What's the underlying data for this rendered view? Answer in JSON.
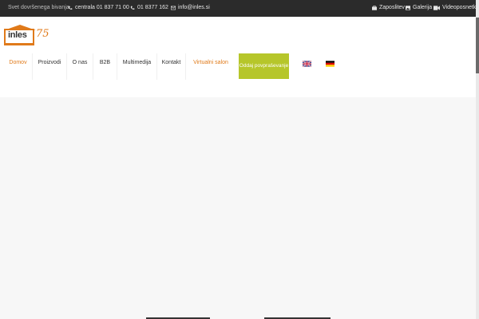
{
  "topbar": {
    "tagline": "Svet dovršenega bivanja",
    "phone_central": "centrala 01 837 71 00",
    "phone_secondary": "01 8377 162",
    "email": "info@inles.si",
    "links": [
      {
        "label": "Zaposlitev",
        "icon": "briefcase-icon"
      },
      {
        "label": "Galerija",
        "icon": "image-icon"
      },
      {
        "label": "Videoposnetki",
        "icon": "video-camera-icon"
      }
    ],
    "text_color": "#e6e6e6",
    "bg_color": "#2b2b2b"
  },
  "logo": {
    "word": "inles",
    "badge": "75",
    "accent_color": "#e07a1a"
  },
  "nav": {
    "items": [
      "Domov",
      "Proizvodi",
      "O nas",
      "B2B",
      "Multimedija",
      "Kontakt",
      "Virtualni salon"
    ],
    "active_item": "Domov",
    "cta_label": "Oddaj povpraševanje",
    "cta_color": "#b6c62a",
    "languages": [
      {
        "name": "English",
        "icon": "uk-flag-icon"
      },
      {
        "name": "Deutsch",
        "icon": "german-flag-icon"
      }
    ]
  }
}
